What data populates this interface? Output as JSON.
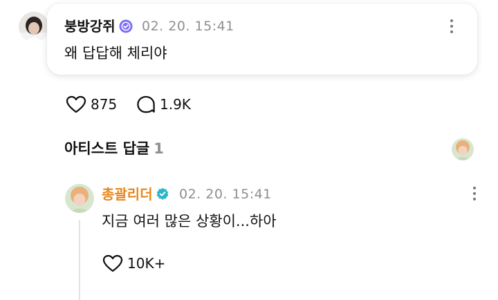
{
  "post": {
    "username": "붕방강쥐",
    "timestamp": "02. 20. 15:41",
    "text": "왜 답답해 체리야",
    "badge_color": "#7b6cf6",
    "likes": "875",
    "comments": "1.9K",
    "menu_icon": "more-vertical-icon"
  },
  "artist_replies": {
    "title": "아티스트 답글",
    "count": "1"
  },
  "reply": {
    "username": "총괄리더",
    "username_color": "#e8861a",
    "badge_color": "#29b6c9",
    "timestamp": "02. 20. 15:41",
    "text": "지금 여러 많은 상황이...하아",
    "likes": "10K+",
    "menu_icon": "more-vertical-icon"
  }
}
